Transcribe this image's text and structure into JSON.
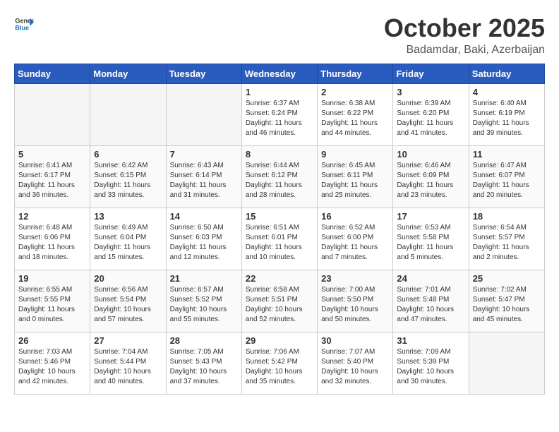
{
  "logo": {
    "text_general": "General",
    "text_blue": "Blue"
  },
  "title": "October 2025",
  "subtitle": "Badamdar, Baki, Azerbaijan",
  "days_of_week": [
    "Sunday",
    "Monday",
    "Tuesday",
    "Wednesday",
    "Thursday",
    "Friday",
    "Saturday"
  ],
  "weeks": [
    [
      {
        "day": "",
        "empty": true
      },
      {
        "day": "",
        "empty": true
      },
      {
        "day": "",
        "empty": true
      },
      {
        "day": "1",
        "sunrise": "6:37 AM",
        "sunset": "6:24 PM",
        "daylight": "11 hours and 46 minutes."
      },
      {
        "day": "2",
        "sunrise": "6:38 AM",
        "sunset": "6:22 PM",
        "daylight": "11 hours and 44 minutes."
      },
      {
        "day": "3",
        "sunrise": "6:39 AM",
        "sunset": "6:20 PM",
        "daylight": "11 hours and 41 minutes."
      },
      {
        "day": "4",
        "sunrise": "6:40 AM",
        "sunset": "6:19 PM",
        "daylight": "11 hours and 39 minutes."
      }
    ],
    [
      {
        "day": "5",
        "sunrise": "6:41 AM",
        "sunset": "6:17 PM",
        "daylight": "11 hours and 36 minutes."
      },
      {
        "day": "6",
        "sunrise": "6:42 AM",
        "sunset": "6:15 PM",
        "daylight": "11 hours and 33 minutes."
      },
      {
        "day": "7",
        "sunrise": "6:43 AM",
        "sunset": "6:14 PM",
        "daylight": "11 hours and 31 minutes."
      },
      {
        "day": "8",
        "sunrise": "6:44 AM",
        "sunset": "6:12 PM",
        "daylight": "11 hours and 28 minutes."
      },
      {
        "day": "9",
        "sunrise": "6:45 AM",
        "sunset": "6:11 PM",
        "daylight": "11 hours and 25 minutes."
      },
      {
        "day": "10",
        "sunrise": "6:46 AM",
        "sunset": "6:09 PM",
        "daylight": "11 hours and 23 minutes."
      },
      {
        "day": "11",
        "sunrise": "6:47 AM",
        "sunset": "6:07 PM",
        "daylight": "11 hours and 20 minutes."
      }
    ],
    [
      {
        "day": "12",
        "sunrise": "6:48 AM",
        "sunset": "6:06 PM",
        "daylight": "11 hours and 18 minutes."
      },
      {
        "day": "13",
        "sunrise": "6:49 AM",
        "sunset": "6:04 PM",
        "daylight": "11 hours and 15 minutes."
      },
      {
        "day": "14",
        "sunrise": "6:50 AM",
        "sunset": "6:03 PM",
        "daylight": "11 hours and 12 minutes."
      },
      {
        "day": "15",
        "sunrise": "6:51 AM",
        "sunset": "6:01 PM",
        "daylight": "11 hours and 10 minutes."
      },
      {
        "day": "16",
        "sunrise": "6:52 AM",
        "sunset": "6:00 PM",
        "daylight": "11 hours and 7 minutes."
      },
      {
        "day": "17",
        "sunrise": "6:53 AM",
        "sunset": "5:58 PM",
        "daylight": "11 hours and 5 minutes."
      },
      {
        "day": "18",
        "sunrise": "6:54 AM",
        "sunset": "5:57 PM",
        "daylight": "11 hours and 2 minutes."
      }
    ],
    [
      {
        "day": "19",
        "sunrise": "6:55 AM",
        "sunset": "5:55 PM",
        "daylight": "11 hours and 0 minutes."
      },
      {
        "day": "20",
        "sunrise": "6:56 AM",
        "sunset": "5:54 PM",
        "daylight": "10 hours and 57 minutes."
      },
      {
        "day": "21",
        "sunrise": "6:57 AM",
        "sunset": "5:52 PM",
        "daylight": "10 hours and 55 minutes."
      },
      {
        "day": "22",
        "sunrise": "6:58 AM",
        "sunset": "5:51 PM",
        "daylight": "10 hours and 52 minutes."
      },
      {
        "day": "23",
        "sunrise": "7:00 AM",
        "sunset": "5:50 PM",
        "daylight": "10 hours and 50 minutes."
      },
      {
        "day": "24",
        "sunrise": "7:01 AM",
        "sunset": "5:48 PM",
        "daylight": "10 hours and 47 minutes."
      },
      {
        "day": "25",
        "sunrise": "7:02 AM",
        "sunset": "5:47 PM",
        "daylight": "10 hours and 45 minutes."
      }
    ],
    [
      {
        "day": "26",
        "sunrise": "7:03 AM",
        "sunset": "5:46 PM",
        "daylight": "10 hours and 42 minutes."
      },
      {
        "day": "27",
        "sunrise": "7:04 AM",
        "sunset": "5:44 PM",
        "daylight": "10 hours and 40 minutes."
      },
      {
        "day": "28",
        "sunrise": "7:05 AM",
        "sunset": "5:43 PM",
        "daylight": "10 hours and 37 minutes."
      },
      {
        "day": "29",
        "sunrise": "7:06 AM",
        "sunset": "5:42 PM",
        "daylight": "10 hours and 35 minutes."
      },
      {
        "day": "30",
        "sunrise": "7:07 AM",
        "sunset": "5:40 PM",
        "daylight": "10 hours and 32 minutes."
      },
      {
        "day": "31",
        "sunrise": "7:09 AM",
        "sunset": "5:39 PM",
        "daylight": "10 hours and 30 minutes."
      },
      {
        "day": "",
        "empty": true
      }
    ]
  ]
}
